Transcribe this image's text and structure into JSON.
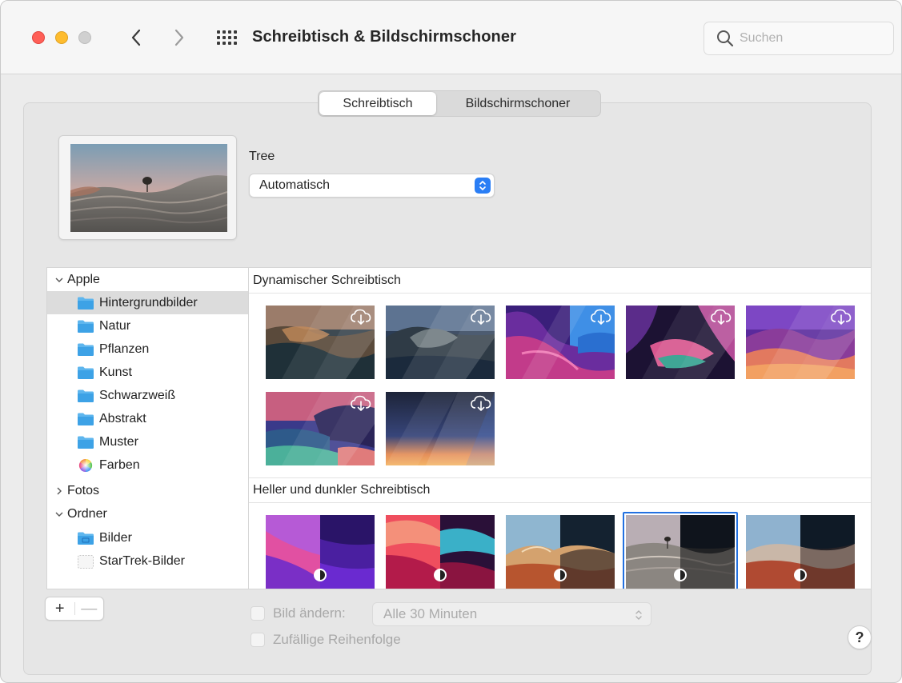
{
  "window": {
    "title": "Schreibtisch & Bildschirmschoner"
  },
  "search": {
    "placeholder": "Suchen"
  },
  "tabs": [
    {
      "label": "Schreibtisch",
      "active": true
    },
    {
      "label": "Bildschirmschoner",
      "active": false
    }
  ],
  "current_wallpaper": {
    "name": "Tree",
    "mode": "Automatisch"
  },
  "sidebar": {
    "groups": [
      {
        "label": "Apple",
        "expanded": true,
        "items": [
          {
            "label": "Hintergrundbilder",
            "icon": "folder-icon",
            "selected": true
          },
          {
            "label": "Natur",
            "icon": "folder-icon"
          },
          {
            "label": "Pflanzen",
            "icon": "folder-icon"
          },
          {
            "label": "Kunst",
            "icon": "folder-icon"
          },
          {
            "label": "Schwarzweiß",
            "icon": "folder-icon"
          },
          {
            "label": "Abstrakt",
            "icon": "folder-icon"
          },
          {
            "label": "Muster",
            "icon": "folder-icon"
          },
          {
            "label": "Farben",
            "icon": "color-wheel-icon"
          }
        ]
      },
      {
        "label": "Fotos",
        "expanded": false,
        "items": []
      },
      {
        "label": "Ordner",
        "expanded": true,
        "items": [
          {
            "label": "Bilder",
            "icon": "pictures-folder-icon"
          },
          {
            "label": "StarTrek-Bilder",
            "icon": "placeholder-folder-icon"
          }
        ]
      }
    ]
  },
  "gallery": {
    "sections": [
      {
        "title": "Dynamischer Schreibtisch",
        "thumbs": [
          {
            "name": "catalina-coast",
            "badge": "cloud-download-icon"
          },
          {
            "name": "catalina-island",
            "badge": "cloud-download-icon"
          },
          {
            "name": "big-sur-graphic",
            "badge": "cloud-download-icon"
          },
          {
            "name": "big-sur-valley",
            "badge": "cloud-download-icon"
          },
          {
            "name": "big-sur-mountains",
            "badge": "cloud-download-icon"
          },
          {
            "name": "big-sur-coastline",
            "badge": "cloud-download-icon"
          },
          {
            "name": "gradient-sky",
            "badge": "cloud-download-icon"
          }
        ]
      },
      {
        "title": "Heller und dunkler Schreibtisch",
        "thumbs": [
          {
            "name": "monterey-purple",
            "badge": "light-dark-icon"
          },
          {
            "name": "monterey-red",
            "badge": "light-dark-icon"
          },
          {
            "name": "desert-rocks",
            "badge": "light-dark-icon"
          },
          {
            "name": "tree-rocks",
            "badge": "light-dark-icon",
            "selected": true
          },
          {
            "name": "red-rocks",
            "badge": "light-dark-icon"
          }
        ]
      }
    ]
  },
  "bottom": {
    "add_label": "+",
    "remove_label": "—",
    "change_picture_label": "Bild ändern:",
    "interval_value": "Alle 30 Minuten",
    "random_order_label": "Zufällige Reihenfolge",
    "help_label": "?"
  },
  "colors": {
    "accent": "#2a7ef5",
    "selection_frame": "#2270e0",
    "close": "#ff5f57",
    "minimize": "#febc2e"
  }
}
